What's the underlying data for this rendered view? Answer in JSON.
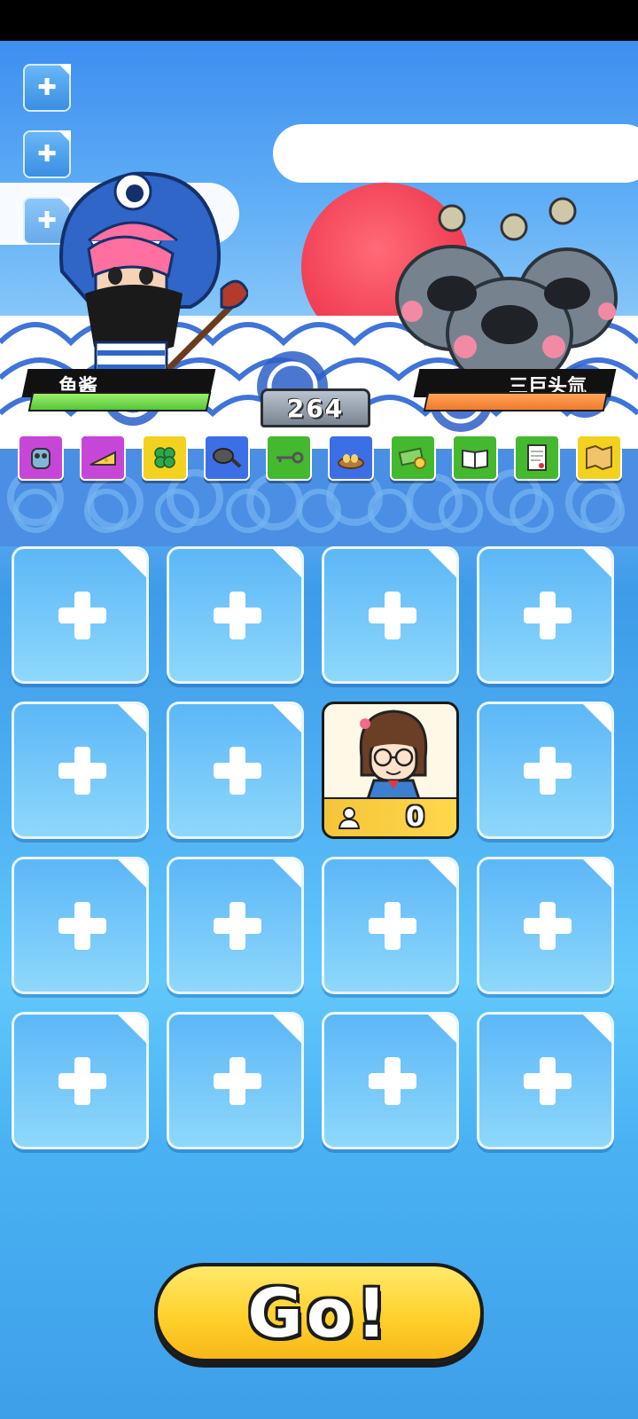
{
  "hero": {
    "name": "鱼酱",
    "hp_fraction": 1.0
  },
  "enemy": {
    "name": "三巨头氚",
    "hp_fraction": 1.0
  },
  "score": "264",
  "side_buttons": [
    {
      "icon": "plus-icon"
    },
    {
      "icon": "plus-icon"
    },
    {
      "icon": "plus-icon"
    }
  ],
  "items": [
    {
      "icon": "robot-icon",
      "color": "#c646d8"
    },
    {
      "icon": "cheese-icon",
      "color": "#c646d8"
    },
    {
      "icon": "clover-icon",
      "color": "#f3d21f"
    },
    {
      "icon": "frying-pan-icon",
      "color": "#3c6ee6"
    },
    {
      "icon": "key-icon",
      "color": "#44b82e"
    },
    {
      "icon": "nest-eggs-icon",
      "color": "#3c6ee6"
    },
    {
      "icon": "cash-icon",
      "color": "#44b82e"
    },
    {
      "icon": "book-icon",
      "color": "#44b82e"
    },
    {
      "icon": "document-icon",
      "color": "#44b82e"
    },
    {
      "icon": "map-icon",
      "color": "#f3d21f"
    }
  ],
  "character_card": {
    "count": "0",
    "icon": "person-icon"
  },
  "go_button": {
    "label": "Go!"
  }
}
